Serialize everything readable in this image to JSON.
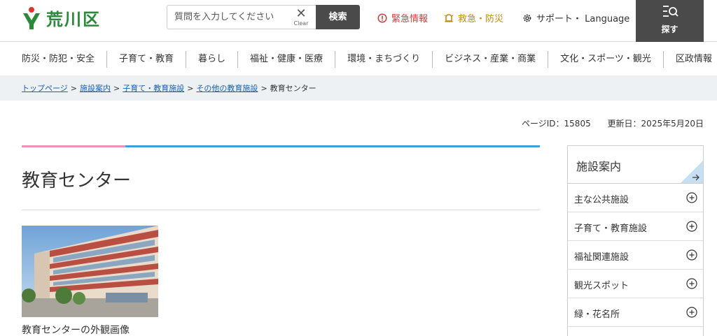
{
  "header": {
    "logo_text": "荒川区",
    "search": {
      "placeholder": "質問を入力してください",
      "clear_label": "Clear",
      "button_label": "検索"
    },
    "links": {
      "emergency": "緊急情報",
      "disaster": "救急・防災",
      "support": "サポート・ Language"
    },
    "sagasu_label": "探す"
  },
  "nav": {
    "items": [
      "防災・防犯・安全",
      "子育て・教育",
      "暮らし",
      "福祉・健康・医療",
      "環境・まちづくり",
      "ビジネス・産業・商業",
      "文化・スポーツ・観光",
      "区政情報"
    ]
  },
  "breadcrumb": {
    "links": [
      "トップページ",
      "施設案内",
      "子育て・教育施設",
      "その他の教育施設"
    ],
    "separator": ">",
    "current": "教育センター"
  },
  "meta": {
    "page_id": "ページID：15805",
    "updated": "更新日：2025年5月20日"
  },
  "main": {
    "title": "教育センター",
    "photo_caption": "教育センターの外観画像"
  },
  "sidebar": {
    "heading": "施設案内",
    "items": [
      "主な公共施設",
      "子育て・教育施設",
      "福祉関連施設",
      "観光スポット",
      "緑・花名所"
    ]
  },
  "colors": {
    "accent_pink": "#e895b8",
    "accent_blue": "#3fa0d8",
    "logo_green": "#2a8a3a",
    "emergency_red": "#d23b3b",
    "disaster_gold": "#c28a00",
    "link_blue": "#1a5fb4"
  }
}
